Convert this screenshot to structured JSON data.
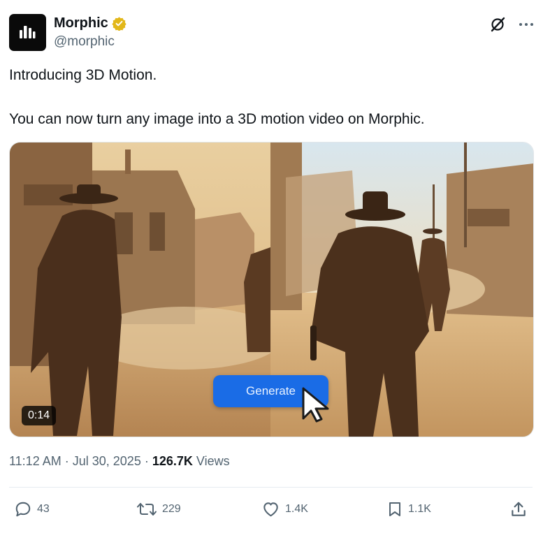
{
  "author": {
    "name": "Morphic",
    "handle": "@morphic",
    "verified": true,
    "verified_color": "#e2b719",
    "avatar_icon": "morphic-logo"
  },
  "post": {
    "line1": "Introducing 3D Motion.",
    "line2": "You can now turn any image into a 3D motion video on Morphic."
  },
  "media": {
    "duration": "0:14",
    "button_label": "Generate",
    "button_color": "#1a6ce6"
  },
  "meta": {
    "time": "11:12 AM",
    "date": "Jul 30, 2025",
    "separator": "·",
    "views_count": "126.7K",
    "views_label": "Views"
  },
  "actions": {
    "replies": "43",
    "reposts": "229",
    "likes": "1.4K",
    "bookmarks": "1.1K"
  },
  "icons": [
    "grok-icon",
    "more-icon",
    "verified-badge-icon",
    "reply-icon",
    "repost-icon",
    "like-icon",
    "bookmark-icon",
    "share-icon",
    "cursor-icon"
  ]
}
